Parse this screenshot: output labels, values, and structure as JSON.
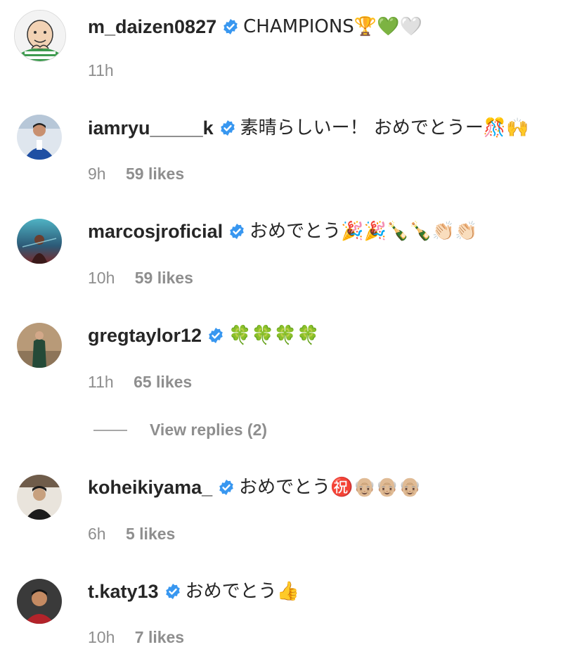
{
  "comments": [
    {
      "username": "m_daizen0827",
      "text": "CHAMPIONS🏆💚🤍",
      "time": "11h",
      "likes": ""
    },
    {
      "username": "iamryu_____k",
      "text": "素晴らしいー！ おめでとうー🎊🙌",
      "time": "9h",
      "likes": "59 likes"
    },
    {
      "username": "marcosjroficial",
      "text": "おめでとう🎉🎉🍾🍾👏🏻👏🏻",
      "time": "10h",
      "likes": "59 likes"
    },
    {
      "username": "gregtaylor12",
      "text": "🍀🍀🍀🍀",
      "time": "11h",
      "likes": "65 likes"
    },
    {
      "username": "koheikiyama_",
      "text": "おめでとう㊗️👴🏼👴🏼👴🏼",
      "time": "6h",
      "likes": "5 likes"
    },
    {
      "username": "t.katy13",
      "text": "おめでとう👍",
      "time": "10h",
      "likes": "7 likes"
    }
  ],
  "view_replies": {
    "label": "View replies (2)"
  },
  "colors": {
    "text_primary": "#262626",
    "text_secondary": "#8e8e8e",
    "verified_blue": "#3897f0"
  },
  "icons": {
    "verified": "verified-badge-icon"
  }
}
